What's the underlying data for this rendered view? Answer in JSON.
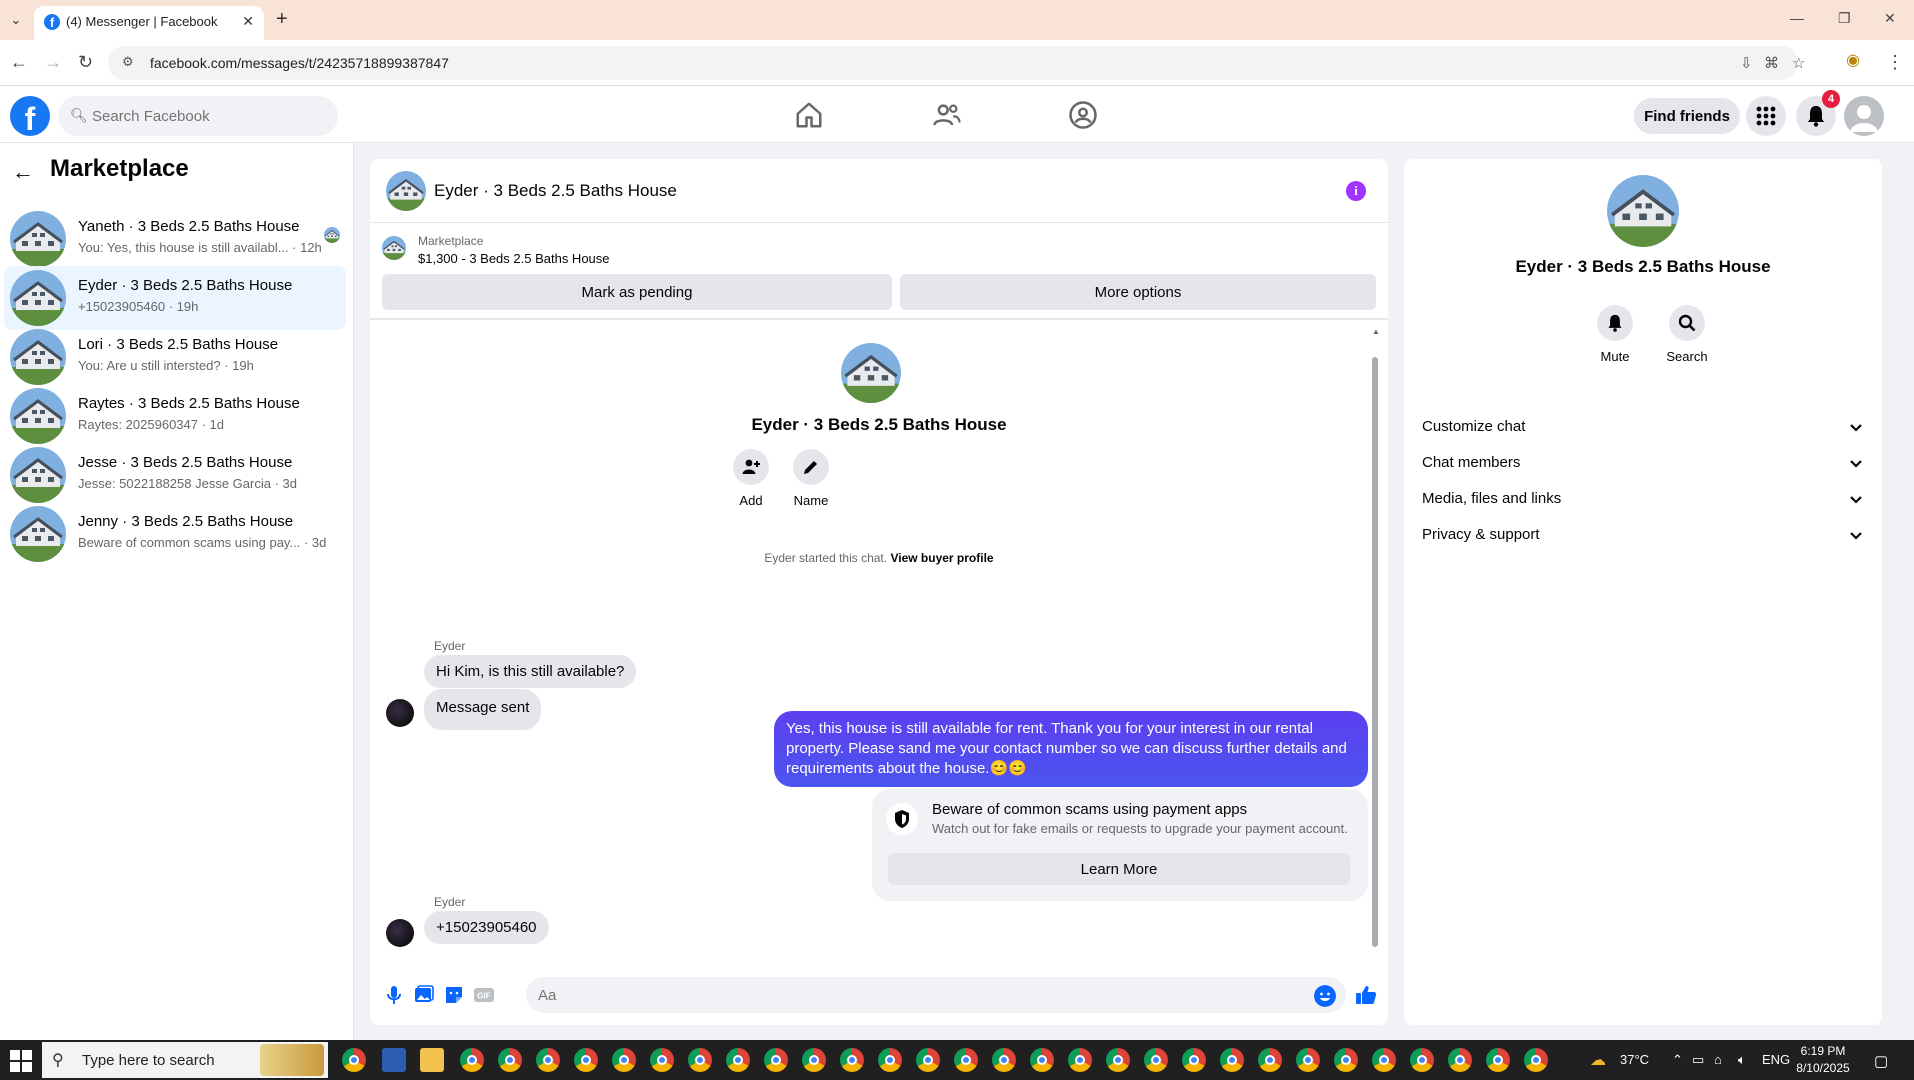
{
  "browser": {
    "tab_title": "(4) Messenger | Facebook",
    "url": "facebook.com/messages/t/24235718899387847"
  },
  "header": {
    "search_placeholder": "Search Facebook",
    "find_friends": "Find friends",
    "notification_count": "4"
  },
  "sidebar": {
    "title": "Marketplace",
    "conversations": [
      {
        "name": "Yaneth · 3 Beds 2.5 Baths House",
        "snippet": "You: Yes, this house is still availabl... · 12h",
        "active": false
      },
      {
        "name": "Eyder · 3 Beds 2.5 Baths House",
        "snippet": "+15023905460 · 19h",
        "active": true
      },
      {
        "name": "Lori · 3 Beds 2.5 Baths House",
        "snippet": "You: Are u still intersted? · 19h",
        "active": false
      },
      {
        "name": "Raytes · 3 Beds 2.5 Baths House",
        "snippet": "Raytes: 2025960347 · 1d",
        "active": false
      },
      {
        "name": "Jesse · 3 Beds 2.5 Baths House",
        "snippet": "Jesse: 5022188258 Jesse Garcia · 3d",
        "active": false
      },
      {
        "name": "Jenny · 3 Beds 2.5 Baths House",
        "snippet": "Beware of common scams using pay... · 3d",
        "active": false
      }
    ]
  },
  "chat": {
    "title": "Eyder · 3 Beds 2.5 Baths House",
    "marketplace_label": "Marketplace",
    "listing": "$1,300 - 3 Beds 2.5 Baths House",
    "mark_pending": "Mark as pending",
    "more_options": "More options",
    "center_name": "Eyder · 3 Beds 2.5 Baths House",
    "add_label": "Add",
    "name_label": "Name",
    "system_text": "Eyder started this chat.",
    "system_link": "View buyer profile",
    "sender_name": "Eyder",
    "msg1": "Hi Kim, is this still available?",
    "msg2": "Message sent",
    "my_message": "Yes, this house is still available for rent. Thank you for your interest in our rental property. Please sand me your contact number so we can discuss further details and requirements about the house.😊😊",
    "warning_title": "Beware of common scams using payment apps",
    "warning_sub": "Watch out for fake emails or requests to upgrade your payment account.",
    "learn_more": "Learn More",
    "msg3": "+15023905460",
    "composer_placeholder": "Aa"
  },
  "info_panel": {
    "name": "Eyder · 3 Beds 2.5 Baths House",
    "mute": "Mute",
    "search": "Search",
    "sections": [
      "Customize chat",
      "Chat members",
      "Media, files and links",
      "Privacy & support"
    ]
  },
  "taskbar": {
    "search_placeholder": "Type here to search",
    "temperature": "37°C",
    "language": "ENG",
    "time": "6:19 PM",
    "date": "8/10/2025"
  },
  "colors": {
    "fb_blue": "#1877f2",
    "messenger_purple": "#5b40e6",
    "active_row": "#ebf5ff"
  }
}
